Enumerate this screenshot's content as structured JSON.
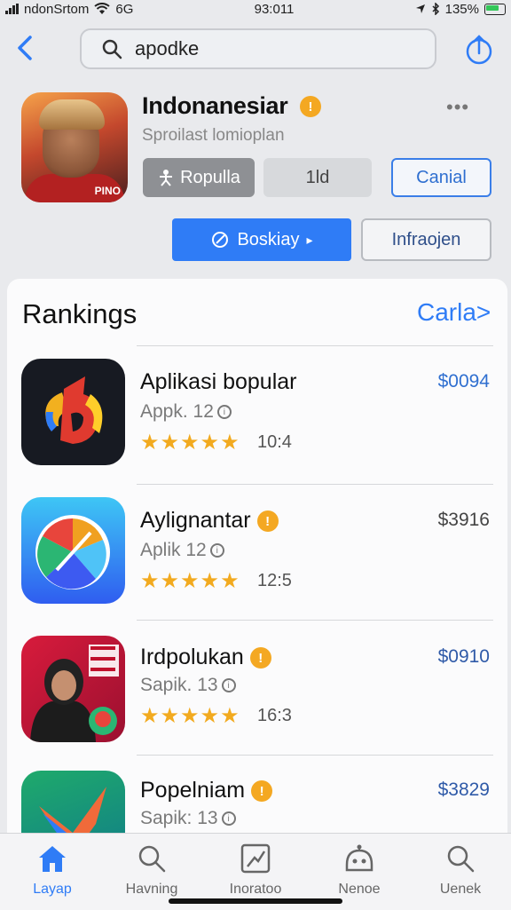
{
  "status": {
    "carrier": "ndonSrtom",
    "network": "6G",
    "time": "93:011",
    "battery_text": "135%"
  },
  "header": {
    "search_value": "apodke"
  },
  "app": {
    "title": "Indonanesiar",
    "subtitle": "Sproilast lomioplan",
    "icon_tag": "PINO",
    "badge_glyph": "!",
    "more_glyph": "•••",
    "btn_popular": "Ropulla",
    "btn_1d": "1ld",
    "btn_cancel": "Canial",
    "btn_primary": "Boskiay",
    "btn_info": "Infraojen"
  },
  "rankings": {
    "title": "Rankings",
    "link": "Carla>",
    "items": [
      {
        "name": "Aplikasi bopular",
        "sub": "Appk. 12",
        "stars": "★★★★★",
        "count": "10:4",
        "price": "$0094",
        "price_color": "#2f6fd0",
        "badge": false
      },
      {
        "name": "Aylignantar",
        "sub": "Aplik 12",
        "stars": "★★★★★",
        "count": "12:5",
        "price": "$3916",
        "price_color": "#444444",
        "badge": true
      },
      {
        "name": "Irdpolukan",
        "sub": "Sapik. 13",
        "stars": "★★★★★",
        "count": "16:3",
        "price": "$0910",
        "price_color": "#2f5aa8",
        "badge": true
      },
      {
        "name": "Popelniam",
        "sub": "Sapik: 13",
        "stars": "",
        "count": "",
        "price": "$3829",
        "price_color": "#2f5aa8",
        "badge": true
      }
    ]
  },
  "tabs": [
    {
      "label": "Layap",
      "icon": "home-icon",
      "active": true
    },
    {
      "label": "Havning",
      "icon": "search-icon",
      "active": false
    },
    {
      "label": "Inoratoo",
      "icon": "chart-icon",
      "active": false
    },
    {
      "label": "Nenoe",
      "icon": "robot-icon",
      "active": false
    },
    {
      "label": "Uenek",
      "icon": "search-icon",
      "active": false
    }
  ],
  "colors": {
    "accent": "#2f7cf6",
    "star": "#f2aa1f",
    "badge": "#f4a822"
  }
}
